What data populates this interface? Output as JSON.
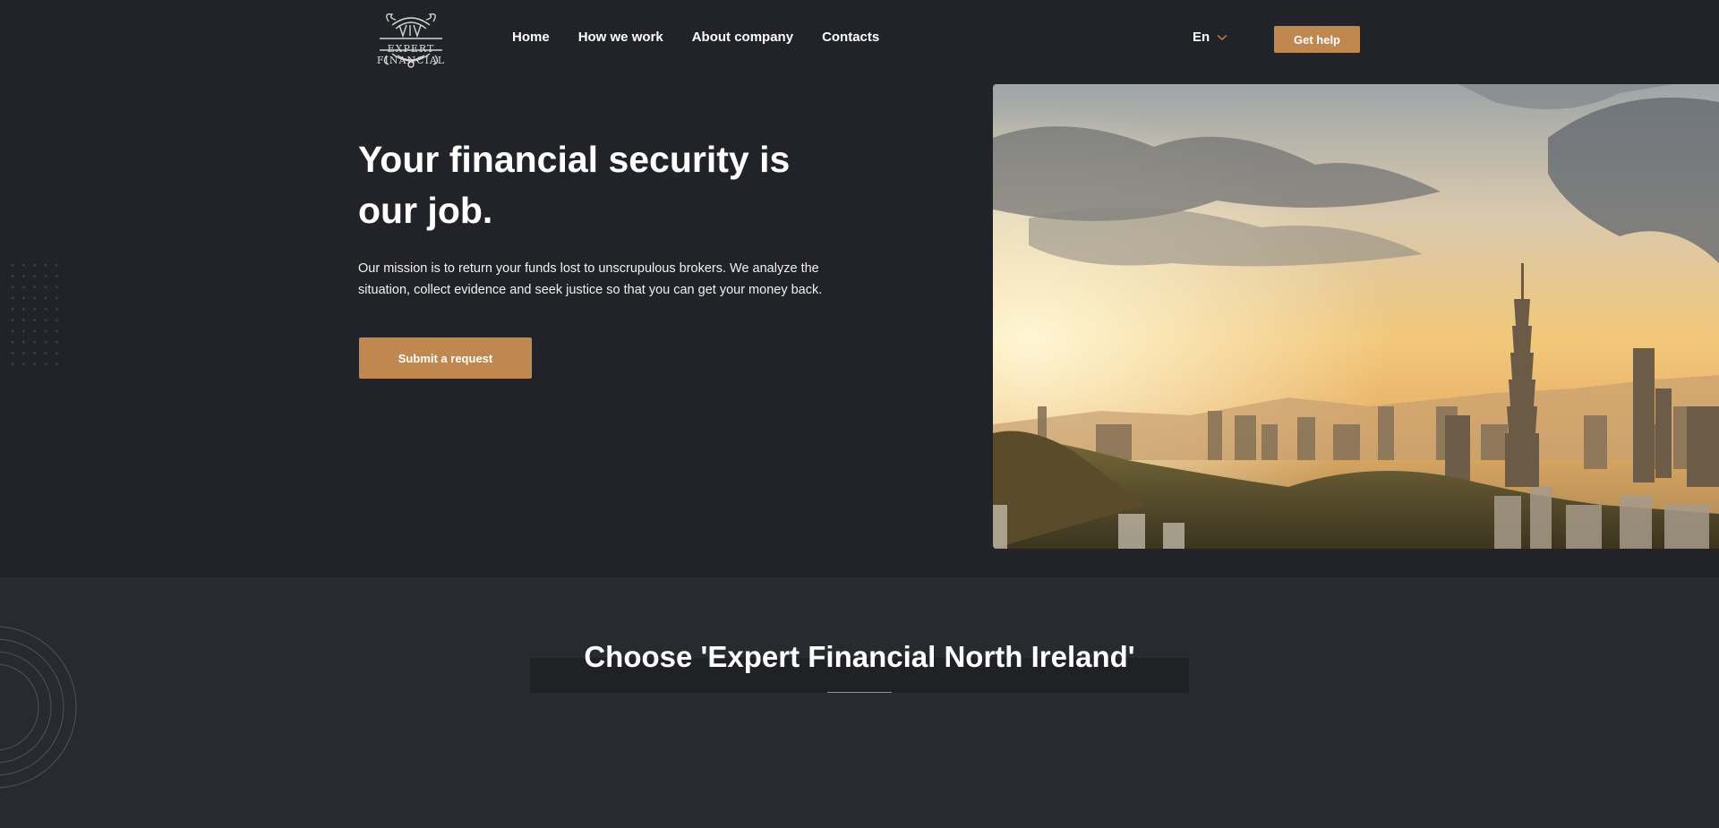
{
  "header": {
    "logo_text": "EXPERT FINANCIAL",
    "nav": [
      "Home",
      "How we work",
      "About company",
      "Contacts"
    ],
    "language": "En",
    "cta_label": "Get help"
  },
  "hero": {
    "title": "Your financial security is our job.",
    "text": "Our mission is to return your funds lost to unscrupulous brokers. We analyze the situation, collect evidence and seek justice so that you can get your money back.",
    "button_label": "Submit a request"
  },
  "section": {
    "title": "Choose 'Expert Financial North Ireland'"
  },
  "colors": {
    "background": "#212328",
    "section_background": "#272a2f",
    "accent": "#c0874f"
  },
  "icons": [
    "logo-emblem",
    "chevron-down-icon",
    "dot-grid-decoration",
    "concentric-circles-decoration"
  ]
}
